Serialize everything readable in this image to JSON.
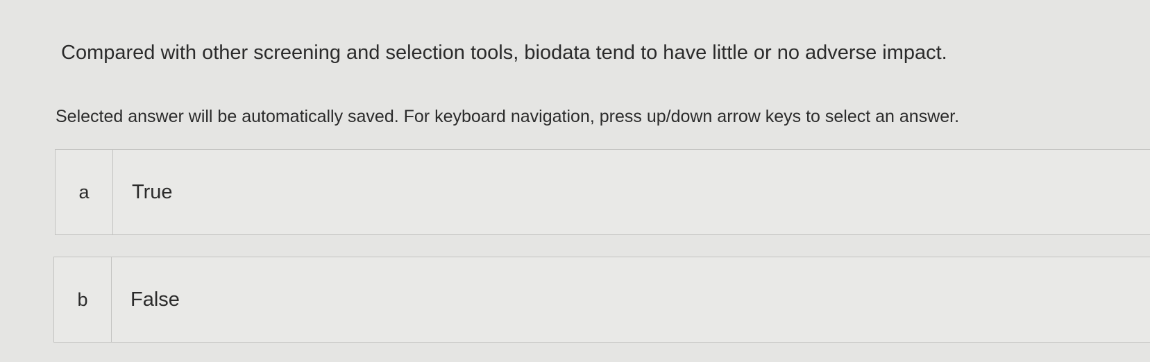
{
  "question": {
    "text": "Compared with other screening and selection tools, biodata tend to have little or no adverse impact."
  },
  "instruction": {
    "text": "Selected answer will be automatically saved. For keyboard navigation, press up/down arrow keys to select an answer."
  },
  "options": [
    {
      "letter": "a",
      "label": "True"
    },
    {
      "letter": "b",
      "label": "False"
    }
  ]
}
